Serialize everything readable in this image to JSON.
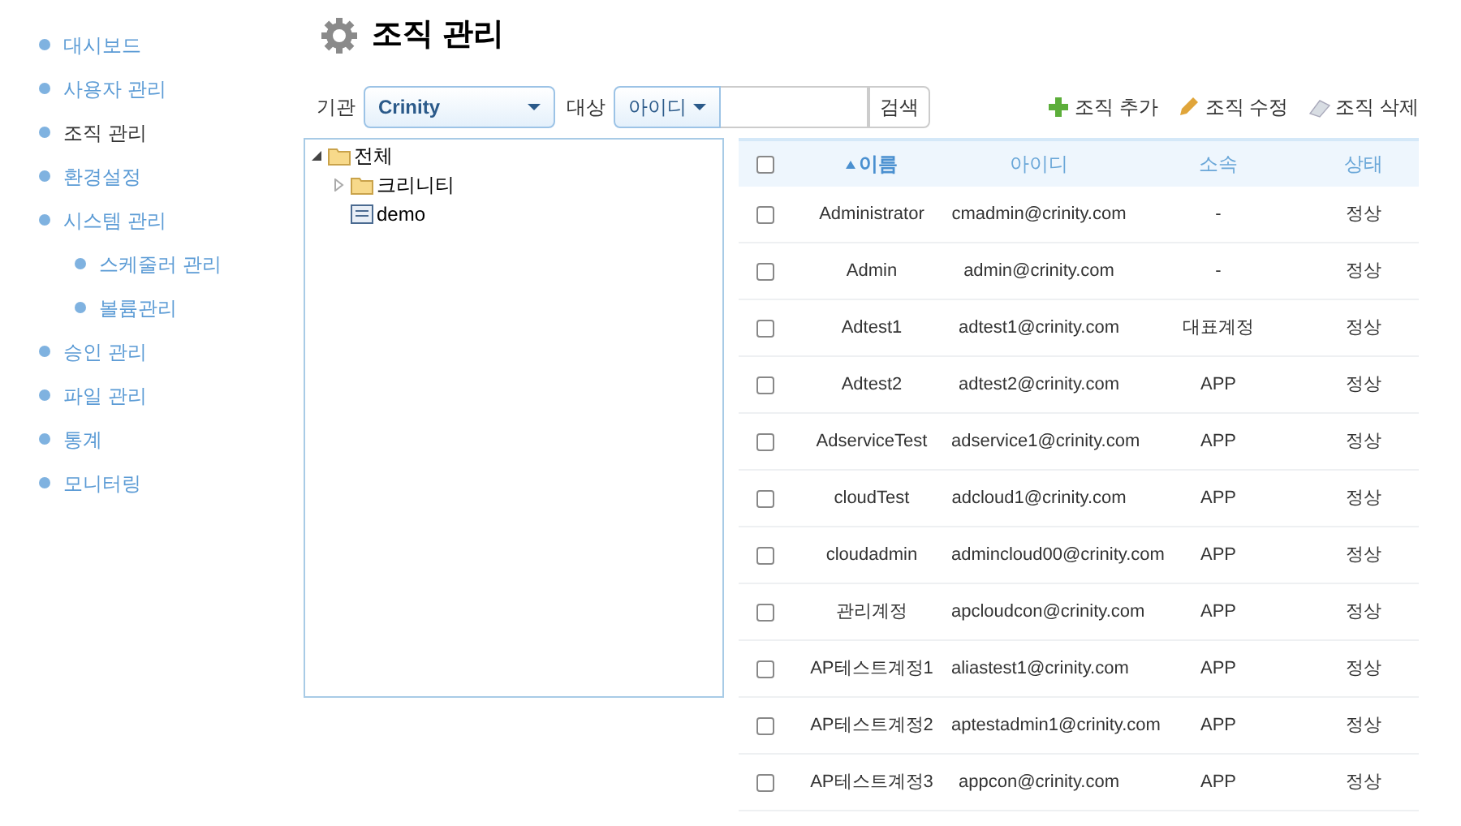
{
  "sidebar": {
    "items": [
      {
        "label": "대시보드",
        "selected": false
      },
      {
        "label": "사용자 관리",
        "selected": false
      },
      {
        "label": "조직 관리",
        "selected": true
      },
      {
        "label": "환경설정",
        "selected": false
      },
      {
        "label": "시스템 관리",
        "selected": false,
        "children": [
          {
            "label": "스케줄러 관리",
            "selected": false
          },
          {
            "label": "볼륨관리",
            "selected": false
          }
        ]
      },
      {
        "label": "승인 관리",
        "selected": false
      },
      {
        "label": "파일 관리",
        "selected": false
      },
      {
        "label": "통계",
        "selected": false
      },
      {
        "label": "모니터링",
        "selected": false
      }
    ]
  },
  "page_title": "조직 관리",
  "filters": {
    "org_label": "기관",
    "org_value": "Crinity",
    "target_label": "대상",
    "target_value": "아이디",
    "search_button": "검색"
  },
  "actions": [
    {
      "kind": "add",
      "label": "조직 추가"
    },
    {
      "kind": "edit",
      "label": "조직 수정"
    },
    {
      "kind": "delete",
      "label": "조직 삭제"
    }
  ],
  "tree": [
    {
      "label": "전체",
      "kind": "folder",
      "expanded": true,
      "children": [
        {
          "label": "크리니티",
          "kind": "folder",
          "expanded": false
        },
        {
          "label": "demo",
          "kind": "item"
        }
      ]
    }
  ],
  "table": {
    "header_checked": false,
    "columns": [
      {
        "label": "이름",
        "sorted": true
      },
      {
        "label": "아이디",
        "sorted": false
      },
      {
        "label": "소속",
        "sorted": false
      },
      {
        "label": "상태",
        "sorted": false
      }
    ],
    "rows": [
      {
        "checked": false,
        "cells": [
          "Administrator",
          "cmadmin@crinity.com",
          "-",
          "정상"
        ]
      },
      {
        "checked": false,
        "cells": [
          "Admin",
          "admin@crinity.com",
          "-",
          "정상"
        ]
      },
      {
        "checked": false,
        "cells": [
          "Adtest1",
          "adtest1@crinity.com",
          "대표계정",
          "정상"
        ]
      },
      {
        "checked": false,
        "cells": [
          "Adtest2",
          "adtest2@crinity.com",
          "APP",
          "정상"
        ]
      },
      {
        "checked": false,
        "cells": [
          "AdserviceTest",
          "adservice1@crinity.com",
          "APP",
          "정상"
        ]
      },
      {
        "checked": false,
        "cells": [
          "cloudTest",
          "adcloud1@crinity.com",
          "APP",
          "정상"
        ]
      },
      {
        "checked": false,
        "cells": [
          "cloudadmin",
          "admincloud00@crinity.com",
          "APP",
          "정상"
        ]
      },
      {
        "checked": false,
        "cells": [
          "관리계정",
          "apcloudcon@crinity.com",
          "APP",
          "정상"
        ]
      },
      {
        "checked": false,
        "cells": [
          "AP테스트계정1",
          "aliastest1@crinity.com",
          "APP",
          "정상"
        ]
      },
      {
        "checked": false,
        "cells": [
          "AP테스트계정2",
          "aptestadmin1@crinity.com",
          "APP",
          "정상"
        ]
      },
      {
        "checked": false,
        "cells": [
          "AP테스트계정3",
          "appcon@crinity.com",
          "APP",
          "정상"
        ]
      }
    ]
  }
}
